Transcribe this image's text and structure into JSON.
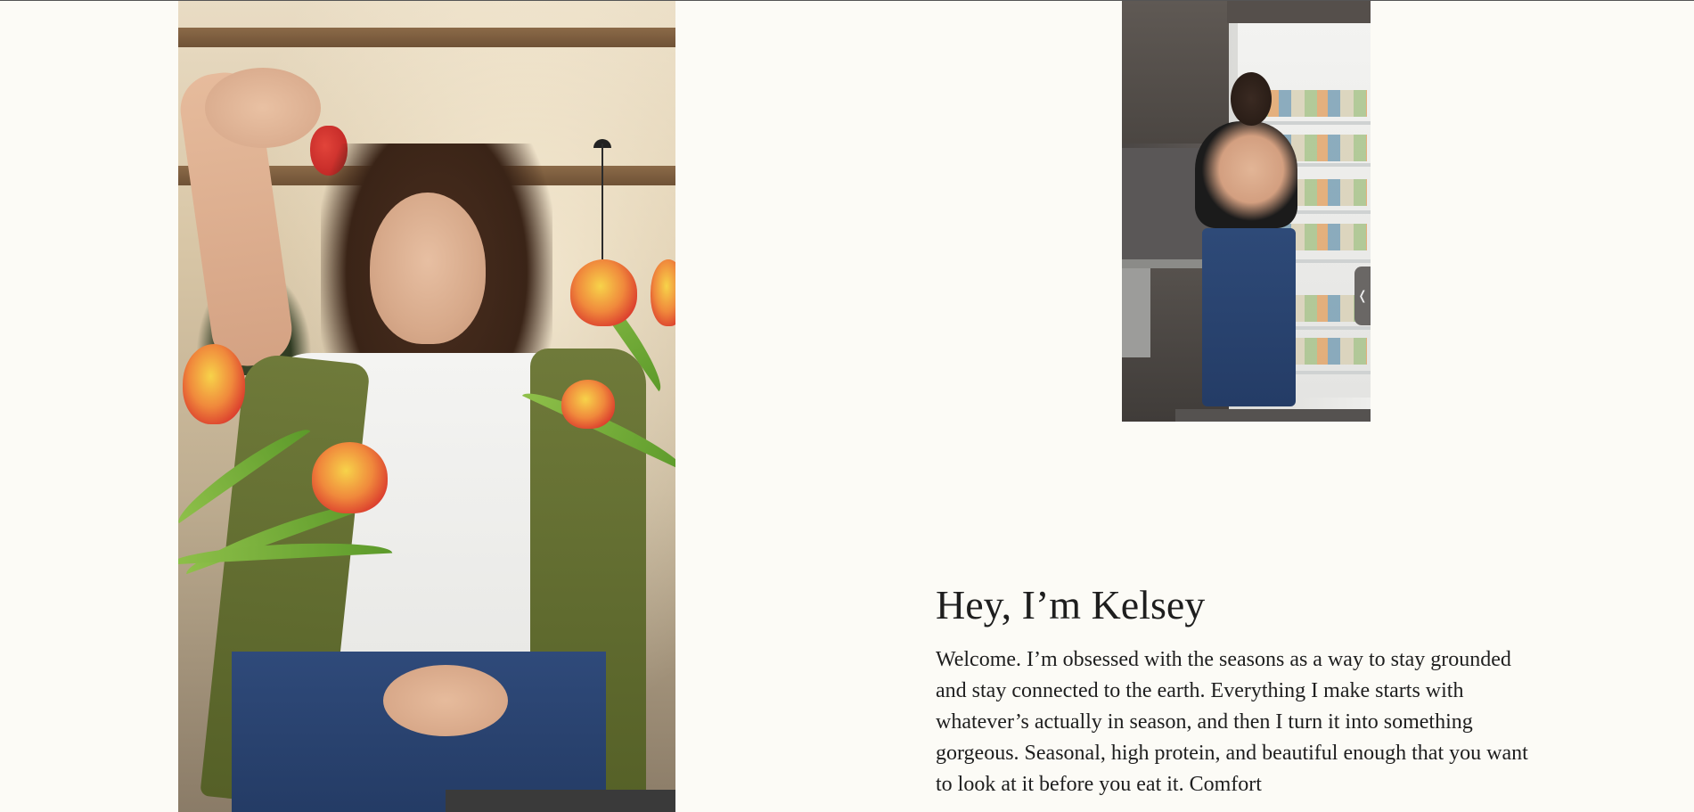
{
  "intro": {
    "heading": "Hey, I’m Kelsey",
    "body": "Welcome. I’m obsessed with the seasons as a way to stay grounded and stay connected to the earth. Everything I make starts with whatever’s actually in season, and then I turn it into something gorgeous. Seasonal, high protein, and beautiful enough that you want to look at it before you eat it. Comfort"
  },
  "gallery": {
    "next_arrow": "❬"
  },
  "colors": {
    "background": "#fcfbf6",
    "text": "#1e1e1e"
  }
}
